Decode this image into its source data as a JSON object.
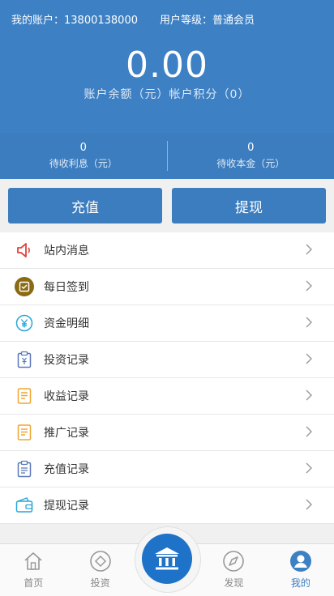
{
  "header": {
    "account_label": "我的账户：13800138000",
    "level_label": "用户等级：普通会员",
    "balance": "0.00",
    "balance_label": "账户余额（元）帐户积分（0）"
  },
  "stats": {
    "interest_value": "0",
    "interest_label": "待收利息（元）",
    "principal_value": "0",
    "principal_label": "待收本金（元）"
  },
  "actions": {
    "recharge_label": "充值",
    "withdraw_label": "提现"
  },
  "menu": {
    "items": [
      {
        "label": "站内消息",
        "icon": "speaker-icon"
      },
      {
        "label": "每日签到",
        "icon": "checkin-icon"
      },
      {
        "label": "资金明细",
        "icon": "yuan-icon"
      },
      {
        "label": "投资记录",
        "icon": "clipboard-icon"
      },
      {
        "label": "收益记录",
        "icon": "document-icon"
      },
      {
        "label": "推广记录",
        "icon": "document-icon"
      },
      {
        "label": "充值记录",
        "icon": "clipboard-icon"
      },
      {
        "label": "提现记录",
        "icon": "wallet-icon"
      }
    ]
  },
  "tabbar": {
    "home": "首页",
    "invest": "投资",
    "discover": "发现",
    "mine": "我的"
  },
  "colors": {
    "primary": "#3d80c4",
    "center_button": "#1e72c7",
    "background": "#f0f0f0"
  }
}
